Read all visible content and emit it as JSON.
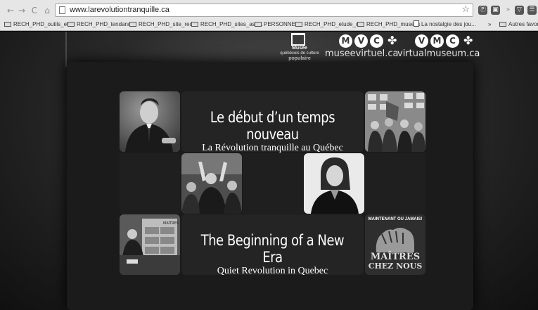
{
  "browser": {
    "url": "www.larevolutiontranquille.ca",
    "back_icon": "←",
    "forward_icon": "→",
    "reload_icon": "C",
    "home_icon": "⌂",
    "star_icon": "☆",
    "extensions": [
      "Ⓟ",
      "▣",
      "»",
      "▽",
      "☰"
    ]
  },
  "bookmarks": [
    "RECH_PHD_outils_et...",
    "RECH_PHD_tendanc...",
    "RECH_PHD_site_rec...",
    "RECH_PHD_sites_ass...",
    "PERSONNEL",
    "RECH_PHD_etude_c...",
    "RECH_PHD_musees",
    "La nostalgie des jou...",
    "»",
    "Autres favoris"
  ],
  "logos": {
    "musee_line1": "Musée",
    "musee_line2": "québécois de culture",
    "musee_line3": "populaire",
    "mvc_letters": [
      "M",
      "V",
      "C"
    ],
    "mvc_site": "museevirtuel.ca",
    "vmc_letters": [
      "V",
      "M",
      "C"
    ],
    "vmc_site": "virtualmuseum.ca"
  },
  "french_banner": {
    "title": "Le début d’un temps nouveau",
    "subtitle": "La Révolution tranquille au Québec"
  },
  "english_banner": {
    "title": "The Beginning of a New Era",
    "subtitle": "Quiet Revolution in Quebec"
  },
  "poster": {
    "top": "MAINTENANT OU JAMAIS!",
    "line1": "MAÎTRES",
    "line2": "CHEZ NOUS"
  },
  "tv_panel_text": "MAÎTRES"
}
